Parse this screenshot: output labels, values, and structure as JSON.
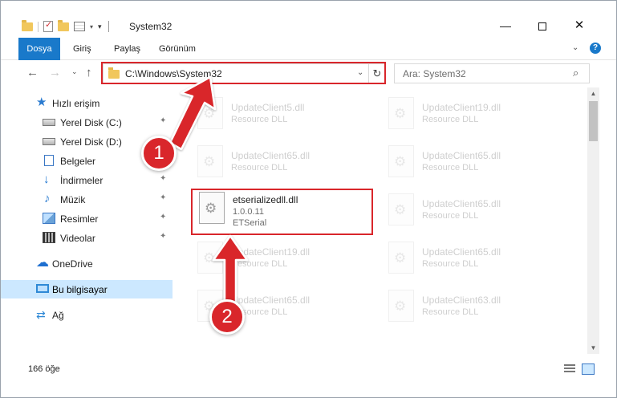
{
  "window": {
    "title": "System32",
    "minimize_glyph": "—",
    "close_glyph": "✕"
  },
  "ribbon": {
    "file_tab": "Dosya",
    "tabs": [
      "Giriş",
      "Paylaş",
      "Görünüm"
    ],
    "help_glyph": "?"
  },
  "navigation": {
    "address_path": "C:\\Windows\\System32",
    "search_placeholder": "Ara: System32"
  },
  "sidebar": {
    "quick_access": "Hızlı erişim",
    "items": [
      {
        "label": "Yerel Disk (C:)",
        "icon": "drive-icon",
        "pinned": true
      },
      {
        "label": "Yerel Disk (D:)",
        "icon": "drive-icon",
        "pinned": false
      },
      {
        "label": "Belgeler",
        "icon": "documents-icon",
        "pinned": true
      },
      {
        "label": "İndirmeler",
        "icon": "downloads-icon",
        "pinned": true
      },
      {
        "label": "Müzik",
        "icon": "music-icon",
        "pinned": true
      },
      {
        "label": "Resimler",
        "icon": "pictures-icon",
        "pinned": true
      },
      {
        "label": "Videolar",
        "icon": "videos-icon",
        "pinned": true
      }
    ],
    "onedrive": "OneDrive",
    "this_pc": "Bu bilgisayar",
    "network": "Ağ"
  },
  "files": {
    "active": {
      "name": "etserializedll.dll",
      "version": "1.0.0.11",
      "company": "ETSerial"
    },
    "background_tiles": [
      {
        "name": "UpdateClient5.dll",
        "desc": "Resource DLL"
      },
      {
        "name": "UpdateClient19.dll",
        "desc": "Resource DLL"
      },
      {
        "name": "UpdateClient65.dll",
        "desc": "Resource DLL"
      },
      {
        "name": "UpdateClient65.dll",
        "desc": "Resource DLL"
      },
      {
        "name": "UpdateClient65.dll",
        "desc": "Resource DLL"
      },
      {
        "name": "UpdateClient19.dll",
        "desc": "Resource DLL"
      },
      {
        "name": "UpdateClient65.dll",
        "desc": "Resource DLL"
      },
      {
        "name": "UpdateClient65.dll",
        "desc": "Resource DLL"
      },
      {
        "name": "UpdateClient63.dll",
        "desc": "Resource DLL"
      }
    ]
  },
  "status": {
    "item_count": "166 öğe"
  },
  "callouts": {
    "step1": "1",
    "step2": "2",
    "accent_color": "#d9262b"
  }
}
